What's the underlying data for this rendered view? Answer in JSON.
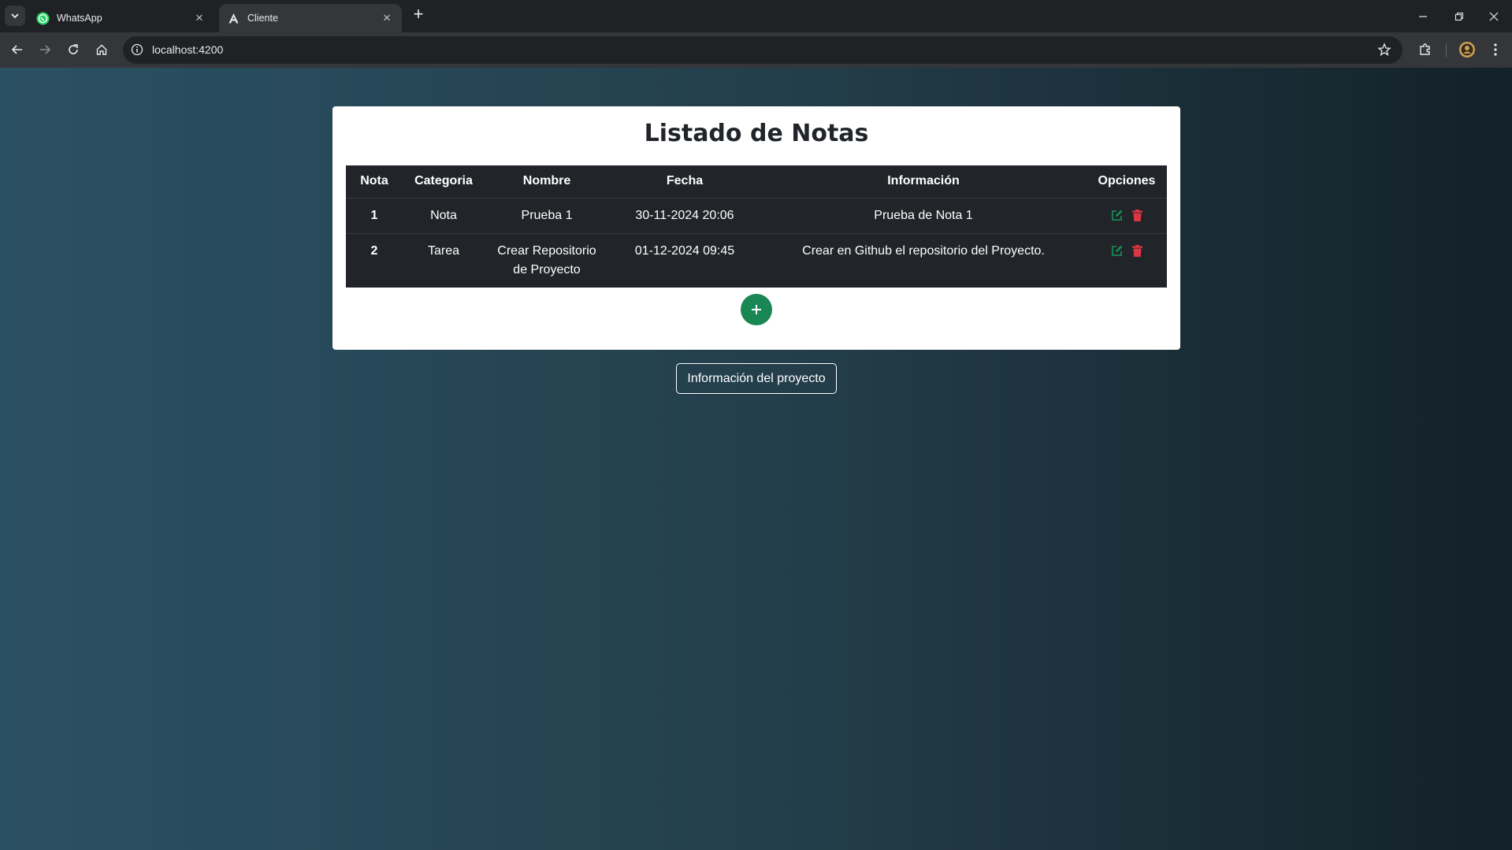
{
  "browser": {
    "tabs": [
      {
        "title": "WhatsApp",
        "icon": "whatsapp-icon",
        "active": false
      },
      {
        "title": "Cliente",
        "icon": "angular-icon",
        "active": true
      }
    ],
    "url": "localhost:4200"
  },
  "page": {
    "title": "Listado de Notas",
    "table": {
      "headers": [
        "Nota",
        "Categoria",
        "Nombre",
        "Fecha",
        "Información",
        "Opciones"
      ],
      "rows": [
        {
          "nota": "1",
          "categoria": "Nota",
          "nombre": "Prueba 1",
          "fecha": "30-11-2024 20:06",
          "informacion": "Prueba de Nota 1"
        },
        {
          "nota": "2",
          "categoria": "Tarea",
          "nombre": "Crear Repositorio de Proyecto",
          "fecha": "01-12-2024 09:45",
          "informacion": "Crear en Github el repositorio del Proyecto."
        }
      ]
    },
    "add_button_icon": "plus-icon",
    "info_button": "Información del proyecto"
  },
  "colors": {
    "table_bg": "#212529",
    "edit_icon": "#198754",
    "delete_icon": "#dc3545",
    "add_button": "#198754"
  }
}
